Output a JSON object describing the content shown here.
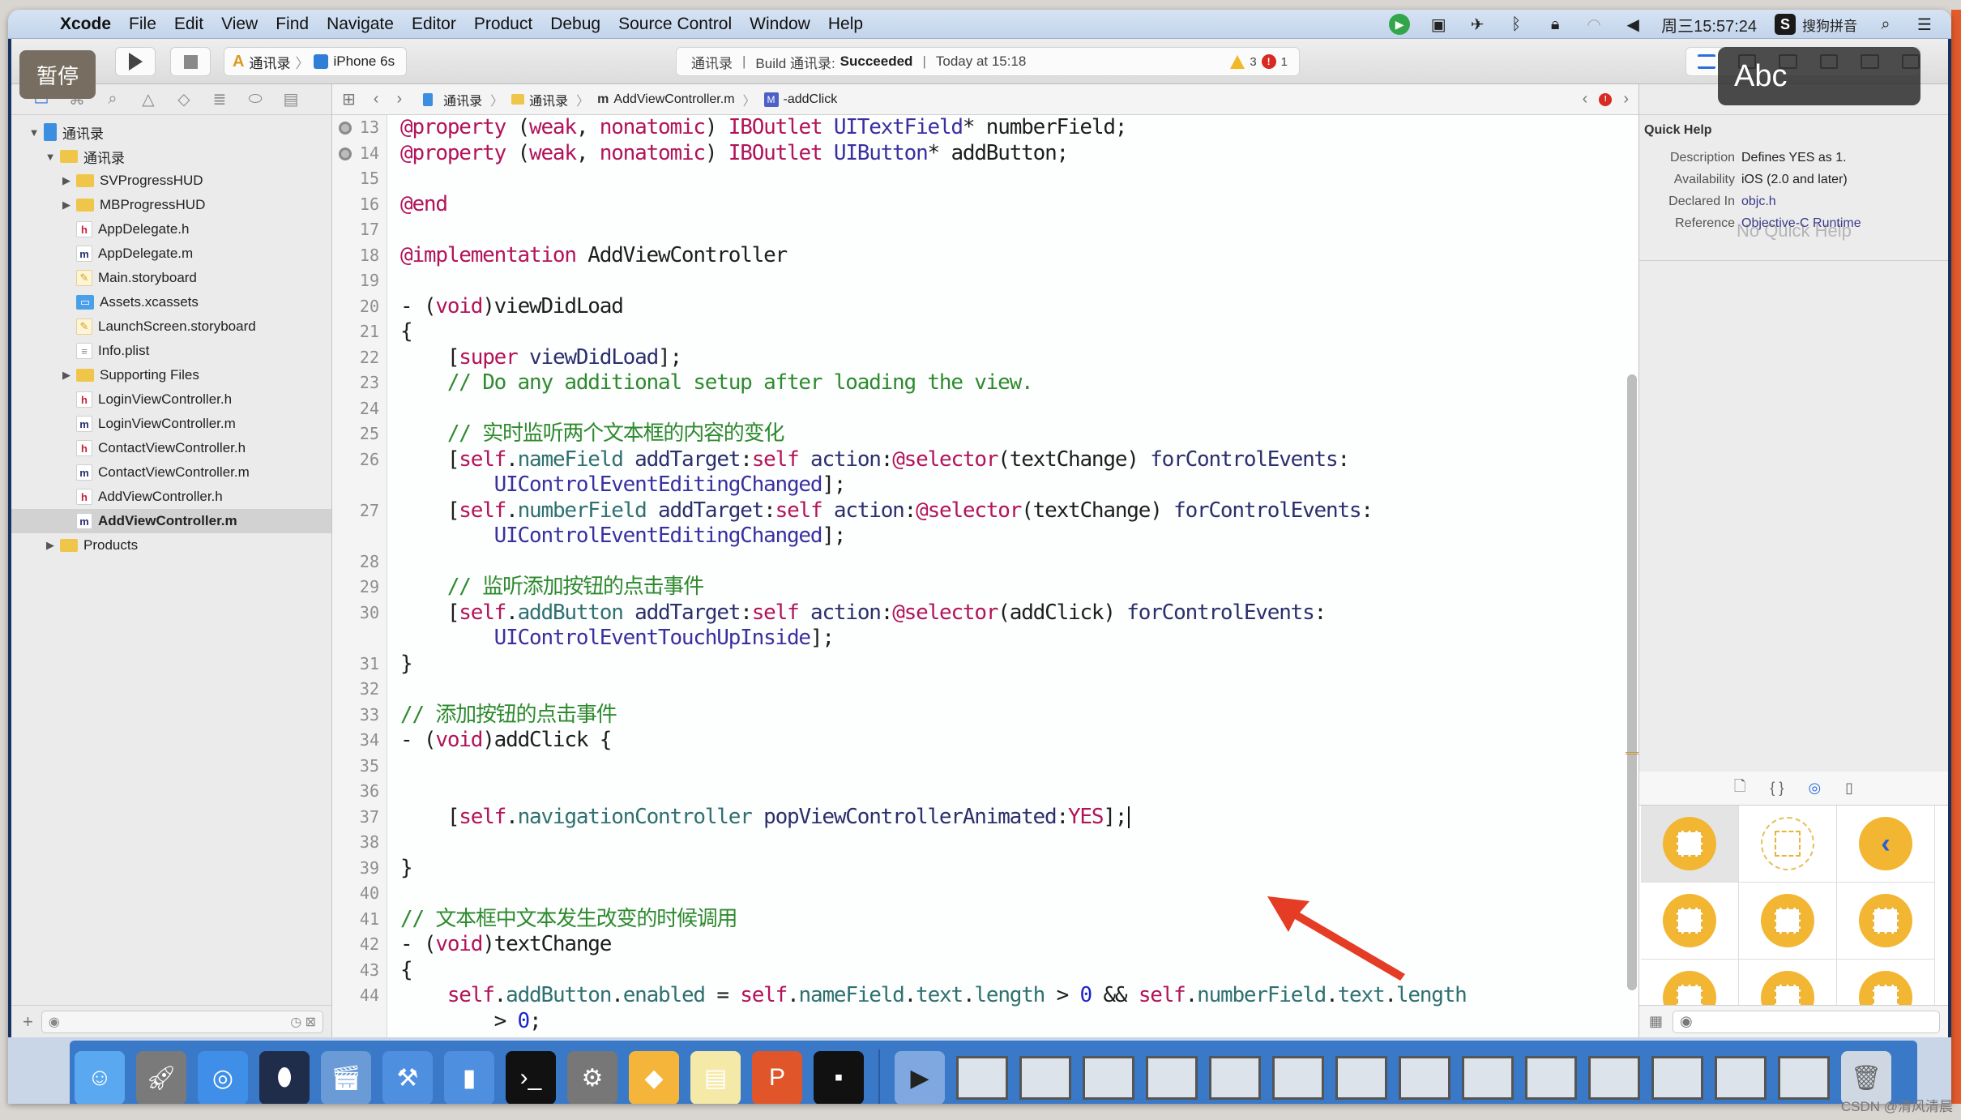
{
  "menubar": {
    "apple_icon": "apple-logo-icon",
    "items": [
      "Xcode",
      "File",
      "Edit",
      "View",
      "Find",
      "Navigate",
      "Editor",
      "Product",
      "Debug",
      "Source Control",
      "Window",
      "Help"
    ],
    "status_icons": [
      "green-app-icon",
      "screen-record-icon",
      "airplane-icon",
      "bluetooth-icon",
      "lock-icon",
      "wifi-icon",
      "volume-icon"
    ],
    "clock": "周三15:57:24",
    "input_method": "搜狗拼音",
    "input_method_badge": "S",
    "search_icon": "⌕",
    "list_icon": "☰"
  },
  "toolbar": {
    "scheme_name": "通讯录",
    "device": "iPhone 6s",
    "activity": {
      "project": "通讯录",
      "build_prefix": "Build 通讯录:",
      "build_status": "Succeeded",
      "time": "Today at 15:18",
      "warnings": "3",
      "errors": "1"
    }
  },
  "overlays": {
    "pause_label": "暂停",
    "ime_popup": "Abc"
  },
  "navigator": {
    "tabs": [
      "project-navigator",
      "symbol-navigator",
      "find-navigator",
      "issue-navigator",
      "test-navigator",
      "debug-navigator",
      "breakpoint-navigator",
      "report-navigator"
    ],
    "tree": [
      {
        "name": "通讯录",
        "type": "project",
        "level": 0,
        "disclosure": "▼"
      },
      {
        "name": "通讯录",
        "type": "folder",
        "level": 1,
        "disclosure": "▼"
      },
      {
        "name": "SVProgressHUD",
        "type": "folder",
        "level": 2,
        "disclosure": "▶"
      },
      {
        "name": "MBProgressHUD",
        "type": "folder",
        "level": 2,
        "disclosure": "▶"
      },
      {
        "name": "AppDelegate.h",
        "type": "h",
        "level": 2,
        "disclosure": ""
      },
      {
        "name": "AppDelegate.m",
        "type": "m",
        "level": 2,
        "disclosure": ""
      },
      {
        "name": "Main.storyboard",
        "type": "sb",
        "level": 2,
        "disclosure": ""
      },
      {
        "name": "Assets.xcassets",
        "type": "assets",
        "level": 2,
        "disclosure": ""
      },
      {
        "name": "LaunchScreen.storyboard",
        "type": "sb",
        "level": 2,
        "disclosure": ""
      },
      {
        "name": "Info.plist",
        "type": "plist",
        "level": 2,
        "disclosure": ""
      },
      {
        "name": "Supporting Files",
        "type": "folder",
        "level": 2,
        "disclosure": "▶"
      },
      {
        "name": "LoginViewController.h",
        "type": "h",
        "level": 2,
        "disclosure": ""
      },
      {
        "name": "LoginViewController.m",
        "type": "m",
        "level": 2,
        "disclosure": ""
      },
      {
        "name": "ContactViewController.h",
        "type": "h",
        "level": 2,
        "disclosure": ""
      },
      {
        "name": "ContactViewController.m",
        "type": "m",
        "level": 2,
        "disclosure": ""
      },
      {
        "name": "AddViewController.h",
        "type": "h",
        "level": 2,
        "disclosure": ""
      },
      {
        "name": "AddViewController.m",
        "type": "m",
        "level": 2,
        "disclosure": "",
        "selected": true
      },
      {
        "name": "Products",
        "type": "folder",
        "level": 1,
        "disclosure": "▶"
      }
    ],
    "filter_placeholder": ""
  },
  "jumpbar": {
    "crumbs": [
      "通讯录",
      "通讯录",
      "AddViewController.m",
      "-addClick"
    ]
  },
  "editor": {
    "lines": [
      {
        "n": "13",
        "outlet": true,
        "html": "<span class='k'>@property</span> (<span class='k'>weak</span>, <span class='k'>nonatomic</span>) <span class='k'>IBOutlet</span> <span class='t'>UITextField</span>* numberField;"
      },
      {
        "n": "14",
        "outlet": true,
        "html": "<span class='k'>@property</span> (<span class='k'>weak</span>, <span class='k'>nonatomic</span>) <span class='k'>IBOutlet</span> <span class='t'>UIButton</span>* addButton;"
      },
      {
        "n": "15",
        "html": ""
      },
      {
        "n": "16",
        "html": "<span class='k'>@end</span>"
      },
      {
        "n": "17",
        "html": ""
      },
      {
        "n": "18",
        "html": "<span class='k'>@implementation</span> AddViewController"
      },
      {
        "n": "19",
        "html": ""
      },
      {
        "n": "20",
        "html": "- (<span class='k'>void</span>)viewDidLoad"
      },
      {
        "n": "21",
        "html": "{"
      },
      {
        "n": "22",
        "html": "    [<span class='k'>super</span> <span class='m'>viewDidLoad</span>];"
      },
      {
        "n": "23",
        "html": "    <span class='c'>// Do any additional setup after loading the view.</span>"
      },
      {
        "n": "24",
        "html": ""
      },
      {
        "n": "25",
        "html": "    <span class='c'>// 实时监听两个文本框的内容的变化</span>"
      },
      {
        "n": "26",
        "html": "    [<span class='k'>self</span>.<span class='p'>nameField</span> <span class='m'>addTarget</span>:<span class='k'>self</span> <span class='m'>action</span>:<span class='k'>@selector</span>(textChange) <span class='m'>forControlEvents</span>:"
      },
      {
        "n": "",
        "html": "        <span class='t'>UIControlEventEditingChanged</span>];"
      },
      {
        "n": "27",
        "html": "    [<span class='k'>self</span>.<span class='p'>numberField</span> <span class='m'>addTarget</span>:<span class='k'>self</span> <span class='m'>action</span>:<span class='k'>@selector</span>(textChange) <span class='m'>forControlEvents</span>:"
      },
      {
        "n": "",
        "html": "        <span class='t'>UIControlEventEditingChanged</span>];"
      },
      {
        "n": "28",
        "html": ""
      },
      {
        "n": "29",
        "html": "    <span class='c'>// 监听添加按钮的点击事件</span>"
      },
      {
        "n": "30",
        "html": "    [<span class='k'>self</span>.<span class='p'>addButton</span> <span class='m'>addTarget</span>:<span class='k'>self</span> <span class='m'>action</span>:<span class='k'>@selector</span>(addClick) <span class='m'>forControlEvents</span>:"
      },
      {
        "n": "",
        "html": "        <span class='t'>UIControlEventTouchUpInside</span>];"
      },
      {
        "n": "31",
        "html": "}"
      },
      {
        "n": "32",
        "html": ""
      },
      {
        "n": "33",
        "html": "<span class='c'>// 添加按钮的点击事件</span>"
      },
      {
        "n": "34",
        "html": "- (<span class='k'>void</span>)addClick {"
      },
      {
        "n": "35",
        "html": ""
      },
      {
        "n": "36",
        "html": ""
      },
      {
        "n": "37",
        "caret": true,
        "html": "    [<span class='k'>self</span>.<span class='p'>navigationController</span> <span class='m'>popViewControllerAnimated</span>:<span class='k'>YES</span>];"
      },
      {
        "n": "38",
        "html": ""
      },
      {
        "n": "39",
        "html": "}"
      },
      {
        "n": "40",
        "html": ""
      },
      {
        "n": "41",
        "html": "<span class='c'>// 文本框中文本发生改变的时候调用</span>"
      },
      {
        "n": "42",
        "html": "- (<span class='k'>void</span>)textChange"
      },
      {
        "n": "43",
        "html": "{"
      },
      {
        "n": "44",
        "html": "    <span class='k'>self</span>.<span class='p'>addButton</span>.<span class='p'>enabled</span> = <span class='k'>self</span>.<span class='p'>nameField</span>.<span class='p'>text</span>.<span class='p'>length</span> &gt; <span class='n'>0</span> &amp;&amp; <span class='k'>self</span>.<span class='p'>numberField</span>.<span class='p'>text</span>.<span class='p'>length</span>"
      },
      {
        "n": "",
        "html": "        &gt; <span class='n'>0</span>;"
      }
    ]
  },
  "quick_help": {
    "title": "Quick Help",
    "rows": [
      {
        "label": "Description",
        "value": "Defines YES as 1.",
        "link": false
      },
      {
        "label": "Availability",
        "value": "iOS (2.0 and later)",
        "link": false
      },
      {
        "label": "Declared In",
        "value": "objc.h",
        "link": true
      },
      {
        "label": "Reference",
        "value": "Objective-C Runtime",
        "link": true
      }
    ],
    "ghost_text": "No Quick Help"
  },
  "library": {
    "tabs": [
      "file-template-library",
      "code-snippet-library",
      "object-library",
      "media-library"
    ],
    "active_tab": "object-library",
    "objects": [
      "view-controller",
      "storyboard-reference",
      "navigation-controller",
      "table-view-controller",
      "collection-view-controller",
      "tab-bar-controller",
      "split-view-controller",
      "page-view-controller",
      "glkit-view-controller"
    ]
  },
  "dock": {
    "apps": [
      "Finder",
      "Launchpad",
      "Safari",
      "Mouse",
      "iMovie",
      "Xcode",
      "Simulator",
      "Terminal",
      "System Preferences",
      "Sketch",
      "Notes",
      "PowerPoint",
      "Console"
    ],
    "minimized_windows": 14,
    "trash": "Trash"
  },
  "watermark": "CSDN @清风清晨",
  "colors": {
    "keyword": "#b3135a",
    "comment": "#2e8a2e",
    "type": "#3b2fa0",
    "annotation_arrow": "#e53c25",
    "library_object": "#f2b632"
  }
}
